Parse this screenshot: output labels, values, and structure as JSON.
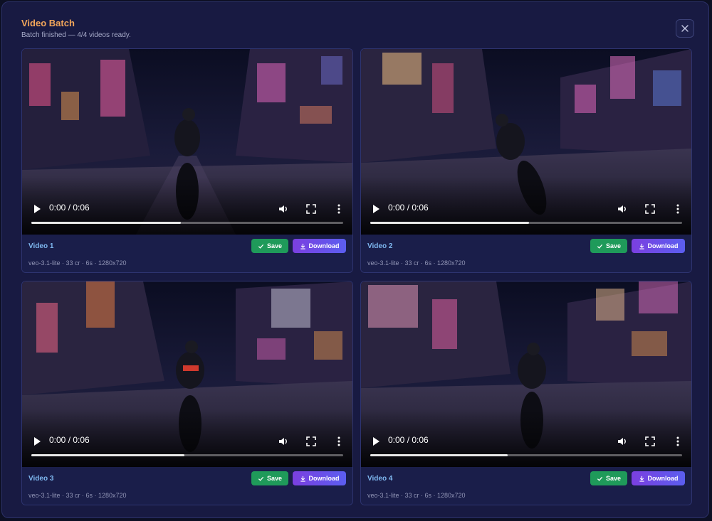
{
  "header": {
    "title": "Video Batch",
    "status": "Batch finished — 4/4 videos ready."
  },
  "videos": [
    {
      "name": "Video 1",
      "time": "0:00 / 0:06",
      "progress": 0.48,
      "save_label": "Save",
      "download_label": "Download",
      "meta": "veo-3.1-lite · 33 cr · 6s · 1280x720"
    },
    {
      "name": "Video 2",
      "time": "0:00 / 0:06",
      "progress": 0.51,
      "save_label": "Save",
      "download_label": "Download",
      "meta": "veo-3.1-lite · 33 cr · 6s · 1280x720"
    },
    {
      "name": "Video 3",
      "time": "0:00 / 0:06",
      "progress": 0.49,
      "save_label": "Save",
      "download_label": "Download",
      "meta": "veo-3.1-lite · 33 cr · 6s · 1280x720"
    },
    {
      "name": "Video 4",
      "time": "0:00 / 0:06",
      "progress": 0.44,
      "save_label": "Save",
      "download_label": "Download",
      "meta": "veo-3.1-lite · 33 cr · 6s · 1280x720"
    }
  ],
  "colors": {
    "title": "#f2a65a",
    "video_name": "#7fb8f0",
    "save": "#1f9a5a",
    "download_from": "#7b3fe0",
    "download_to": "#5b5ef0"
  },
  "icons": {
    "close": "close-icon",
    "play": "play-icon",
    "volume": "volume-icon",
    "fullscreen": "fullscreen-icon",
    "more": "more-vertical-icon",
    "save": "check-icon",
    "download": "download-icon"
  }
}
